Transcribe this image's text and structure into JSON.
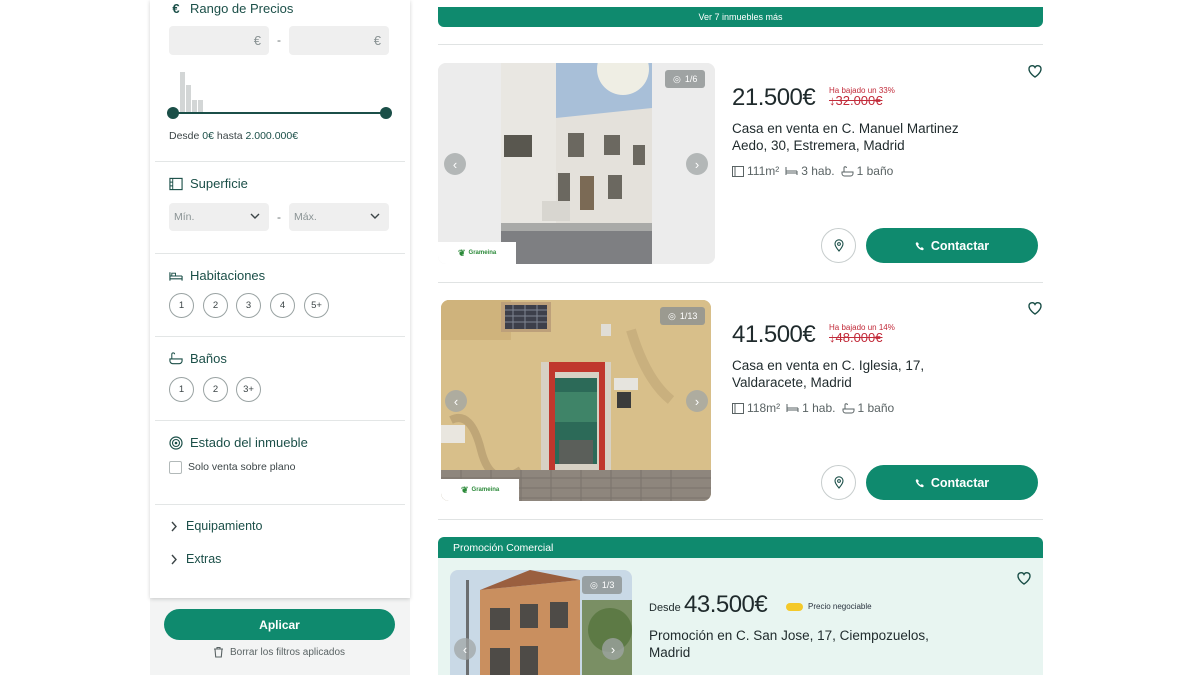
{
  "sidebar": {
    "price": {
      "title": "Rango de Precios",
      "currency_icon": "€",
      "min_placeholder": "€",
      "max_placeholder": "€",
      "dash": "-",
      "range_prefix": "Desde",
      "range_min": "0€",
      "range_mid": "hasta",
      "range_max": "2.000.000€"
    },
    "surface": {
      "title": "Superficie",
      "min_label": "Mín.",
      "max_label": "Máx.",
      "dash": "-"
    },
    "rooms": {
      "title": "Habitaciones",
      "options": [
        "1",
        "2",
        "3",
        "4",
        "5+"
      ]
    },
    "baths": {
      "title": "Baños",
      "options": [
        "1",
        "2",
        "3+"
      ]
    },
    "state": {
      "title": "Estado del inmueble",
      "checkbox_label": "Solo venta sobre plano"
    },
    "equipment": {
      "label": "Equipamiento"
    },
    "extras": {
      "label": "Extras"
    },
    "apply_label": "Aplicar",
    "clear_label": "Borrar los filtros aplicados"
  },
  "main": {
    "see_more_label": "Ver 7 inmuebles más",
    "listings": [
      {
        "counter": "1/6",
        "price": "21.500€",
        "drop_note": "Ha bajado un 33%",
        "old_price": "↓32.000€",
        "title": "Casa en venta en C. Manuel Martinez Aedo, 30, Estremera, Madrid",
        "area": "111m²",
        "rooms": "3 hab.",
        "baths": "1 baño",
        "agency": "Grameina",
        "contact_label": "Contactar"
      },
      {
        "counter": "1/13",
        "price": "41.500€",
        "drop_note": "Ha bajado un 14%",
        "old_price": "↓48.000€",
        "title": "Casa en venta en C. Iglesia, 17, Valdaracete, Madrid",
        "area": "118m²",
        "rooms": "1 hab.",
        "baths": "1 baño",
        "agency": "Grameina",
        "contact_label": "Contactar"
      }
    ],
    "promo": {
      "header": "Promoción Comercial",
      "counter": "1/3",
      "desde": "Desde",
      "price": "43.500€",
      "negotiable": "Precio negociable",
      "title": "Promoción en C. San Jose, 17, Ciempozuelos, Madrid"
    }
  },
  "colors": {
    "brand": "#0f8a6e",
    "dark_green": "#1b4f48",
    "price_drop": "#c22b3a",
    "promo_bg": "#e8f5f1",
    "badge_yellow": "#f4c92a"
  }
}
